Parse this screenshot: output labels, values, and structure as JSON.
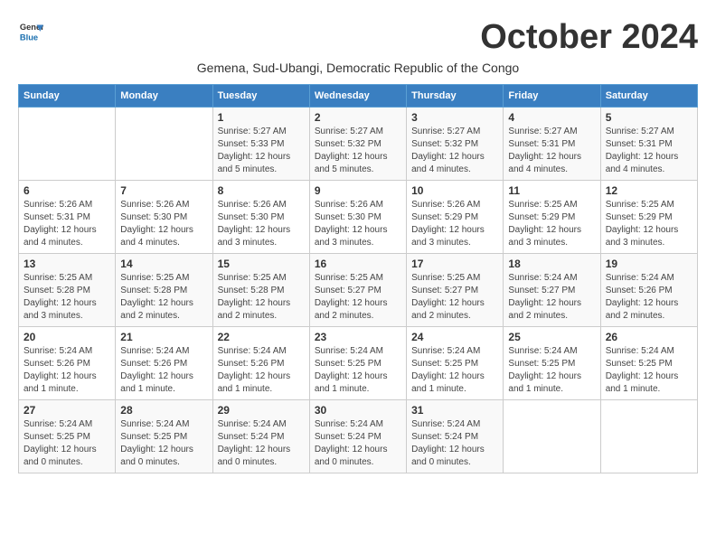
{
  "logo": {
    "general": "General",
    "blue": "Blue"
  },
  "title": "October 2024",
  "subtitle": "Gemena, Sud-Ubangi, Democratic Republic of the Congo",
  "days_of_week": [
    "Sunday",
    "Monday",
    "Tuesday",
    "Wednesday",
    "Thursday",
    "Friday",
    "Saturday"
  ],
  "weeks": [
    [
      {
        "day": "",
        "info": ""
      },
      {
        "day": "",
        "info": ""
      },
      {
        "day": "1",
        "info": "Sunrise: 5:27 AM\nSunset: 5:33 PM\nDaylight: 12 hours\nand 5 minutes."
      },
      {
        "day": "2",
        "info": "Sunrise: 5:27 AM\nSunset: 5:32 PM\nDaylight: 12 hours\nand 5 minutes."
      },
      {
        "day": "3",
        "info": "Sunrise: 5:27 AM\nSunset: 5:32 PM\nDaylight: 12 hours\nand 4 minutes."
      },
      {
        "day": "4",
        "info": "Sunrise: 5:27 AM\nSunset: 5:31 PM\nDaylight: 12 hours\nand 4 minutes."
      },
      {
        "day": "5",
        "info": "Sunrise: 5:27 AM\nSunset: 5:31 PM\nDaylight: 12 hours\nand 4 minutes."
      }
    ],
    [
      {
        "day": "6",
        "info": "Sunrise: 5:26 AM\nSunset: 5:31 PM\nDaylight: 12 hours\nand 4 minutes."
      },
      {
        "day": "7",
        "info": "Sunrise: 5:26 AM\nSunset: 5:30 PM\nDaylight: 12 hours\nand 4 minutes."
      },
      {
        "day": "8",
        "info": "Sunrise: 5:26 AM\nSunset: 5:30 PM\nDaylight: 12 hours\nand 3 minutes."
      },
      {
        "day": "9",
        "info": "Sunrise: 5:26 AM\nSunset: 5:30 PM\nDaylight: 12 hours\nand 3 minutes."
      },
      {
        "day": "10",
        "info": "Sunrise: 5:26 AM\nSunset: 5:29 PM\nDaylight: 12 hours\nand 3 minutes."
      },
      {
        "day": "11",
        "info": "Sunrise: 5:25 AM\nSunset: 5:29 PM\nDaylight: 12 hours\nand 3 minutes."
      },
      {
        "day": "12",
        "info": "Sunrise: 5:25 AM\nSunset: 5:29 PM\nDaylight: 12 hours\nand 3 minutes."
      }
    ],
    [
      {
        "day": "13",
        "info": "Sunrise: 5:25 AM\nSunset: 5:28 PM\nDaylight: 12 hours\nand 3 minutes."
      },
      {
        "day": "14",
        "info": "Sunrise: 5:25 AM\nSunset: 5:28 PM\nDaylight: 12 hours\nand 2 minutes."
      },
      {
        "day": "15",
        "info": "Sunrise: 5:25 AM\nSunset: 5:28 PM\nDaylight: 12 hours\nand 2 minutes."
      },
      {
        "day": "16",
        "info": "Sunrise: 5:25 AM\nSunset: 5:27 PM\nDaylight: 12 hours\nand 2 minutes."
      },
      {
        "day": "17",
        "info": "Sunrise: 5:25 AM\nSunset: 5:27 PM\nDaylight: 12 hours\nand 2 minutes."
      },
      {
        "day": "18",
        "info": "Sunrise: 5:24 AM\nSunset: 5:27 PM\nDaylight: 12 hours\nand 2 minutes."
      },
      {
        "day": "19",
        "info": "Sunrise: 5:24 AM\nSunset: 5:26 PM\nDaylight: 12 hours\nand 2 minutes."
      }
    ],
    [
      {
        "day": "20",
        "info": "Sunrise: 5:24 AM\nSunset: 5:26 PM\nDaylight: 12 hours\nand 1 minute."
      },
      {
        "day": "21",
        "info": "Sunrise: 5:24 AM\nSunset: 5:26 PM\nDaylight: 12 hours\nand 1 minute."
      },
      {
        "day": "22",
        "info": "Sunrise: 5:24 AM\nSunset: 5:26 PM\nDaylight: 12 hours\nand 1 minute."
      },
      {
        "day": "23",
        "info": "Sunrise: 5:24 AM\nSunset: 5:25 PM\nDaylight: 12 hours\nand 1 minute."
      },
      {
        "day": "24",
        "info": "Sunrise: 5:24 AM\nSunset: 5:25 PM\nDaylight: 12 hours\nand 1 minute."
      },
      {
        "day": "25",
        "info": "Sunrise: 5:24 AM\nSunset: 5:25 PM\nDaylight: 12 hours\nand 1 minute."
      },
      {
        "day": "26",
        "info": "Sunrise: 5:24 AM\nSunset: 5:25 PM\nDaylight: 12 hours\nand 1 minute."
      }
    ],
    [
      {
        "day": "27",
        "info": "Sunrise: 5:24 AM\nSunset: 5:25 PM\nDaylight: 12 hours\nand 0 minutes."
      },
      {
        "day": "28",
        "info": "Sunrise: 5:24 AM\nSunset: 5:25 PM\nDaylight: 12 hours\nand 0 minutes."
      },
      {
        "day": "29",
        "info": "Sunrise: 5:24 AM\nSunset: 5:24 PM\nDaylight: 12 hours\nand 0 minutes."
      },
      {
        "day": "30",
        "info": "Sunrise: 5:24 AM\nSunset: 5:24 PM\nDaylight: 12 hours\nand 0 minutes."
      },
      {
        "day": "31",
        "info": "Sunrise: 5:24 AM\nSunset: 5:24 PM\nDaylight: 12 hours\nand 0 minutes."
      },
      {
        "day": "",
        "info": ""
      },
      {
        "day": "",
        "info": ""
      }
    ]
  ]
}
